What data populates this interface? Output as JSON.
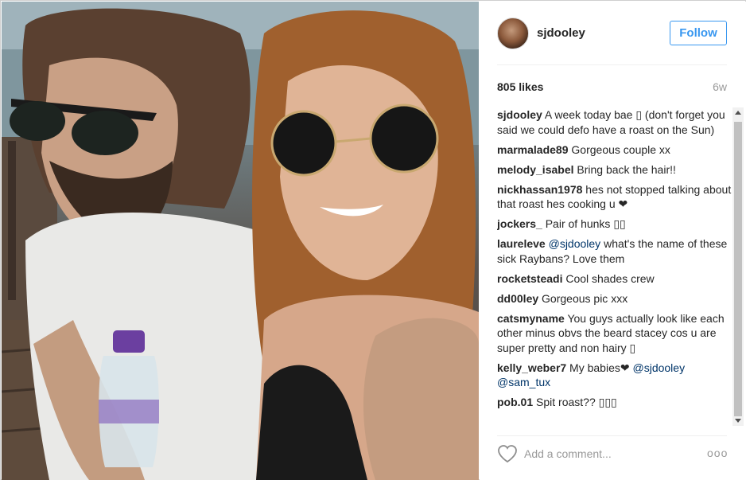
{
  "post": {
    "username": "sjdooley",
    "follow_label": "Follow",
    "likes": "805 likes",
    "age": "6w",
    "comment_placeholder": "Add a comment...",
    "more_label": "ooo"
  },
  "comments": [
    {
      "user": "sjdooley",
      "text": " A week today bae ▯ (don't forget you said we could defo have a roast on the Sun)"
    },
    {
      "user": "marmalade89",
      "text": " Gorgeous couple xx"
    },
    {
      "user": "melody_isabel",
      "text": " Bring back the hair!!"
    },
    {
      "user": "nickhassan1978",
      "text": " hes not stopped talking about that roast hes cooking u ❤"
    },
    {
      "user": "jockers_",
      "text": " Pair of hunks ▯▯"
    },
    {
      "user": "laureleve",
      "mention": "@sjdooley",
      "text": " what's the name of these sick Raybans? Love them"
    },
    {
      "user": "rocketsteadi",
      "text": " Cool shades crew"
    },
    {
      "user": "dd00ley",
      "text": " Gorgeous pic xxx"
    },
    {
      "user": "catsmyname",
      "text": " You guys actually look like each other minus obvs the beard stacey cos u are super pretty and non hairy ▯"
    },
    {
      "user": "kelly_weber7",
      "text": " My babies❤ ",
      "mention": "@sjdooley",
      "mention2": "@sam_tux"
    },
    {
      "user": "pob.01",
      "text": " Spit roast?? ▯▯▯"
    }
  ],
  "colors": {
    "accent": "#3897f0",
    "mention": "#003569",
    "muted": "#999999"
  },
  "icons": {
    "like": "heart-icon",
    "options": "more-options-icon"
  }
}
